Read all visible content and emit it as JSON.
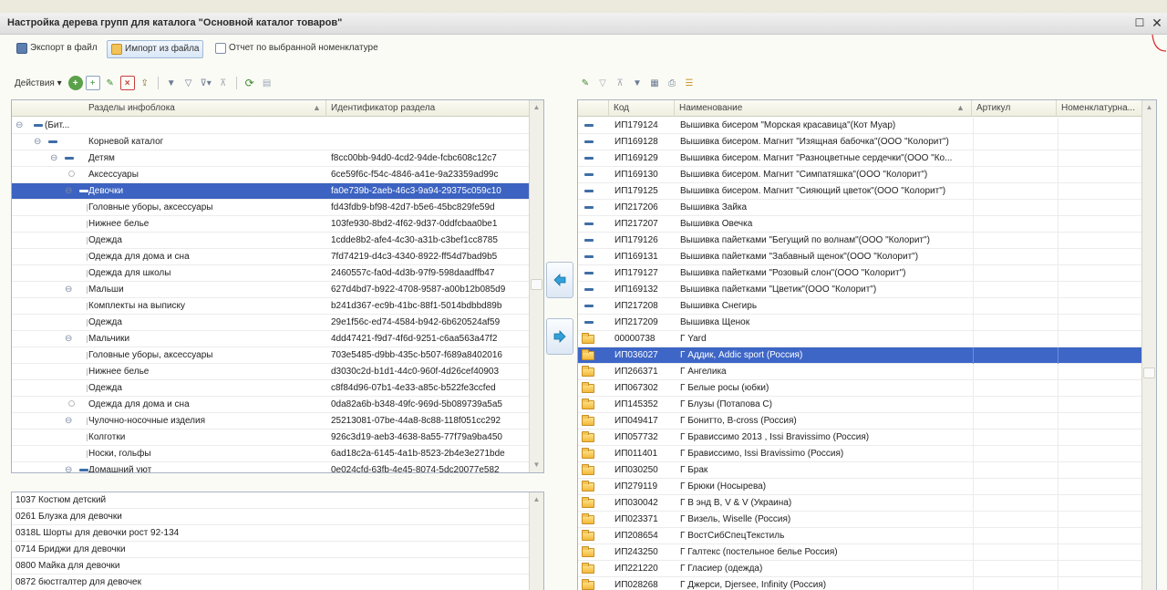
{
  "window": {
    "title": "Настройка дерева групп для каталога \"Основной каталог товаров\""
  },
  "commands": {
    "export_label": "Экспорт в файл",
    "import_label": "Импорт из файла",
    "report_label": "Отчет по выбранной номенклатуре"
  },
  "left_toolbar": {
    "actions_label": "Действия"
  },
  "tree": {
    "columns": [
      "Разделы инфоблока",
      "Идентификатор раздела"
    ],
    "rows": [
      {
        "name": "(Бит...",
        "id": ""
      },
      {
        "name": "Корневой каталог",
        "id": ""
      },
      {
        "name": "Детям",
        "id": "f8cc00bb-94d0-4cd2-94de-fcbc608c12c7"
      },
      {
        "name": "Аксессуары",
        "id": "6ce59f6c-f54c-4846-a41e-9a23359ad99c"
      },
      {
        "name": "Девочки",
        "id": "fa0e739b-2aeb-46c3-9a94-29375c059c10"
      },
      {
        "name": "Головные уборы, аксессуары",
        "id": "fd43fdb9-bf98-42d7-b5e6-45bc829fe59d"
      },
      {
        "name": "Нижнее белье",
        "id": "103fe930-8bd2-4f62-9d37-0ddfcbaa0be1"
      },
      {
        "name": "Одежда",
        "id": "1cdde8b2-afe4-4c30-a31b-c3bef1cc8785"
      },
      {
        "name": "Одежда для дома и сна",
        "id": "7fd74219-d4c3-4340-8922-ff54d7bad9b5"
      },
      {
        "name": "Одежда для школы",
        "id": "2460557c-fa0d-4d3b-97f9-598daadffb47"
      },
      {
        "name": "Мальши",
        "id": "627d4bd7-b922-4708-9587-a00b12b085d9"
      },
      {
        "name": "Комплекты на выписку",
        "id": "b241d367-ec9b-41bc-88f1-5014bdbbd89b"
      },
      {
        "name": "Одежда",
        "id": "29e1f56c-ed74-4584-b942-6b620524af59"
      },
      {
        "name": "Мальчики",
        "id": "4dd47421-f9d7-4f6d-9251-c6aa563a47f2"
      },
      {
        "name": "Головные уборы, аксессуары",
        "id": "703e5485-d9bb-435c-b507-f689a8402016"
      },
      {
        "name": "Нижнее белье",
        "id": "d3030c2d-b1d1-44c0-960f-4d26cef40903"
      },
      {
        "name": "Одежда",
        "id": "c8f84d96-07b1-4e33-a85c-b522fe3ccfed"
      },
      {
        "name": "Одежда для дома и сна",
        "id": "0da82a6b-b348-49fc-969d-5b089739a5a5"
      },
      {
        "name": "Чулочно-носочные изделия",
        "id": "25213081-07be-44a8-8c88-118f051cc292"
      },
      {
        "name": "Колготки",
        "id": "926c3d19-aeb3-4638-8a55-77f79a9ba450"
      },
      {
        "name": "Носки, гольфы",
        "id": "6ad18c2a-6145-4a1b-8523-2b4e3e271bde"
      },
      {
        "name": "Домашний уют",
        "id": "0e024cfd-63fb-4e45-8074-5dc20077e582"
      }
    ]
  },
  "items_list": [
    "1037 Костюм детский",
    "0261 Блузка для девочки",
    "0318L Шорты для девочки рост 92-134",
    "0714 Бриджи для девочки",
    "0800 Майка для девочки",
    "0872 бюстгалтер для девочек"
  ],
  "grid": {
    "columns": [
      "Код",
      "Наименование",
      "Артикул",
      "Номенклатурна..."
    ],
    "rows": [
      {
        "code": "ИП179124",
        "name": "Вышивка бисером \"Морская красавица\"(Кот Муар)",
        "kind": "item"
      },
      {
        "code": "ИП169128",
        "name": "Вышивка бисером. Магнит \"Изящная бабочка\"(ООО \"Колорит\")",
        "kind": "item"
      },
      {
        "code": "ИП169129",
        "name": "Вышивка бисером. Магнит \"Разноцветные сердечки\"(ООО \"Ко...",
        "kind": "item"
      },
      {
        "code": "ИП169130",
        "name": "Вышивка бисером. Магнит \"Симпатяшка\"(ООО \"Колорит\")",
        "kind": "item"
      },
      {
        "code": "ИП179125",
        "name": "Вышивка бисером. Магнит \"Сияющий цветок\"(ООО \"Колорит\")",
        "kind": "item"
      },
      {
        "code": "ИП217206",
        "name": "Вышивка Зайка",
        "kind": "item"
      },
      {
        "code": "ИП217207",
        "name": "Вышивка Овечка",
        "kind": "item"
      },
      {
        "code": "ИП179126",
        "name": "Вышивка пайетками \"Бегущий по волнам\"(ООО \"Колорит\")",
        "kind": "item"
      },
      {
        "code": "ИП169131",
        "name": "Вышивка пайетками \"Забавный щенок\"(ООО \"Колорит\")",
        "kind": "item"
      },
      {
        "code": "ИП179127",
        "name": "Вышивка пайетками \"Розовый слон\"(ООО \"Колорит\")",
        "kind": "item"
      },
      {
        "code": "ИП169132",
        "name": "Вышивка пайетками \"Цветик\"(ООО \"Колорит\")",
        "kind": "item"
      },
      {
        "code": "ИП217208",
        "name": "Вышивка Снегирь",
        "kind": "item"
      },
      {
        "code": "ИП217209",
        "name": "Вышивка Щенок",
        "kind": "item"
      },
      {
        "code": "00000738",
        "name": "Г Yard",
        "kind": "folder"
      },
      {
        "code": "ИП036027",
        "name": "Г Аддик, Addic sport (Россия)",
        "kind": "folder"
      },
      {
        "code": "ИП266371",
        "name": "Г Ангелика",
        "kind": "folder"
      },
      {
        "code": "ИП067302",
        "name": "Г Белые росы (юбки)",
        "kind": "folder"
      },
      {
        "code": "ИП145352",
        "name": "Г Блузы (Потапова С)",
        "kind": "folder"
      },
      {
        "code": "ИП049417",
        "name": "Г Бонитто, B-cross (Россия)",
        "kind": "folder"
      },
      {
        "code": "ИП057732",
        "name": "Г Брависсимо 2013 , Issi Bravissimo (Россия)",
        "kind": "folder"
      },
      {
        "code": "ИП011401",
        "name": "Г Брависсимо, Issi Bravissimo (Россия)",
        "kind": "folder"
      },
      {
        "code": "ИП030250",
        "name": "Г Брак",
        "kind": "folder"
      },
      {
        "code": "ИП279119",
        "name": "Г Брюки (Носырева)",
        "kind": "folder"
      },
      {
        "code": "ИП030042",
        "name": "Г В энд В, V & V (Украина)",
        "kind": "folder"
      },
      {
        "code": "ИП023371",
        "name": "Г Визель, Wiselle (Россия)",
        "kind": "folder"
      },
      {
        "code": "ИП208654",
        "name": "Г ВостСибСпецТекстиль",
        "kind": "folder"
      },
      {
        "code": "ИП243250",
        "name": "Г Галтекс (постельное белье Россия)",
        "kind": "folder"
      },
      {
        "code": "ИП221220",
        "name": "Г Гласиер (одежда)",
        "kind": "folder"
      },
      {
        "code": "ИП028268",
        "name": "Г Джерси, Djersee, Infinity (Россия)",
        "kind": "folder"
      }
    ]
  },
  "colors": {
    "selection": "#3c63c1",
    "accent": "#3f6ea8",
    "folder": "#f2b93a"
  }
}
